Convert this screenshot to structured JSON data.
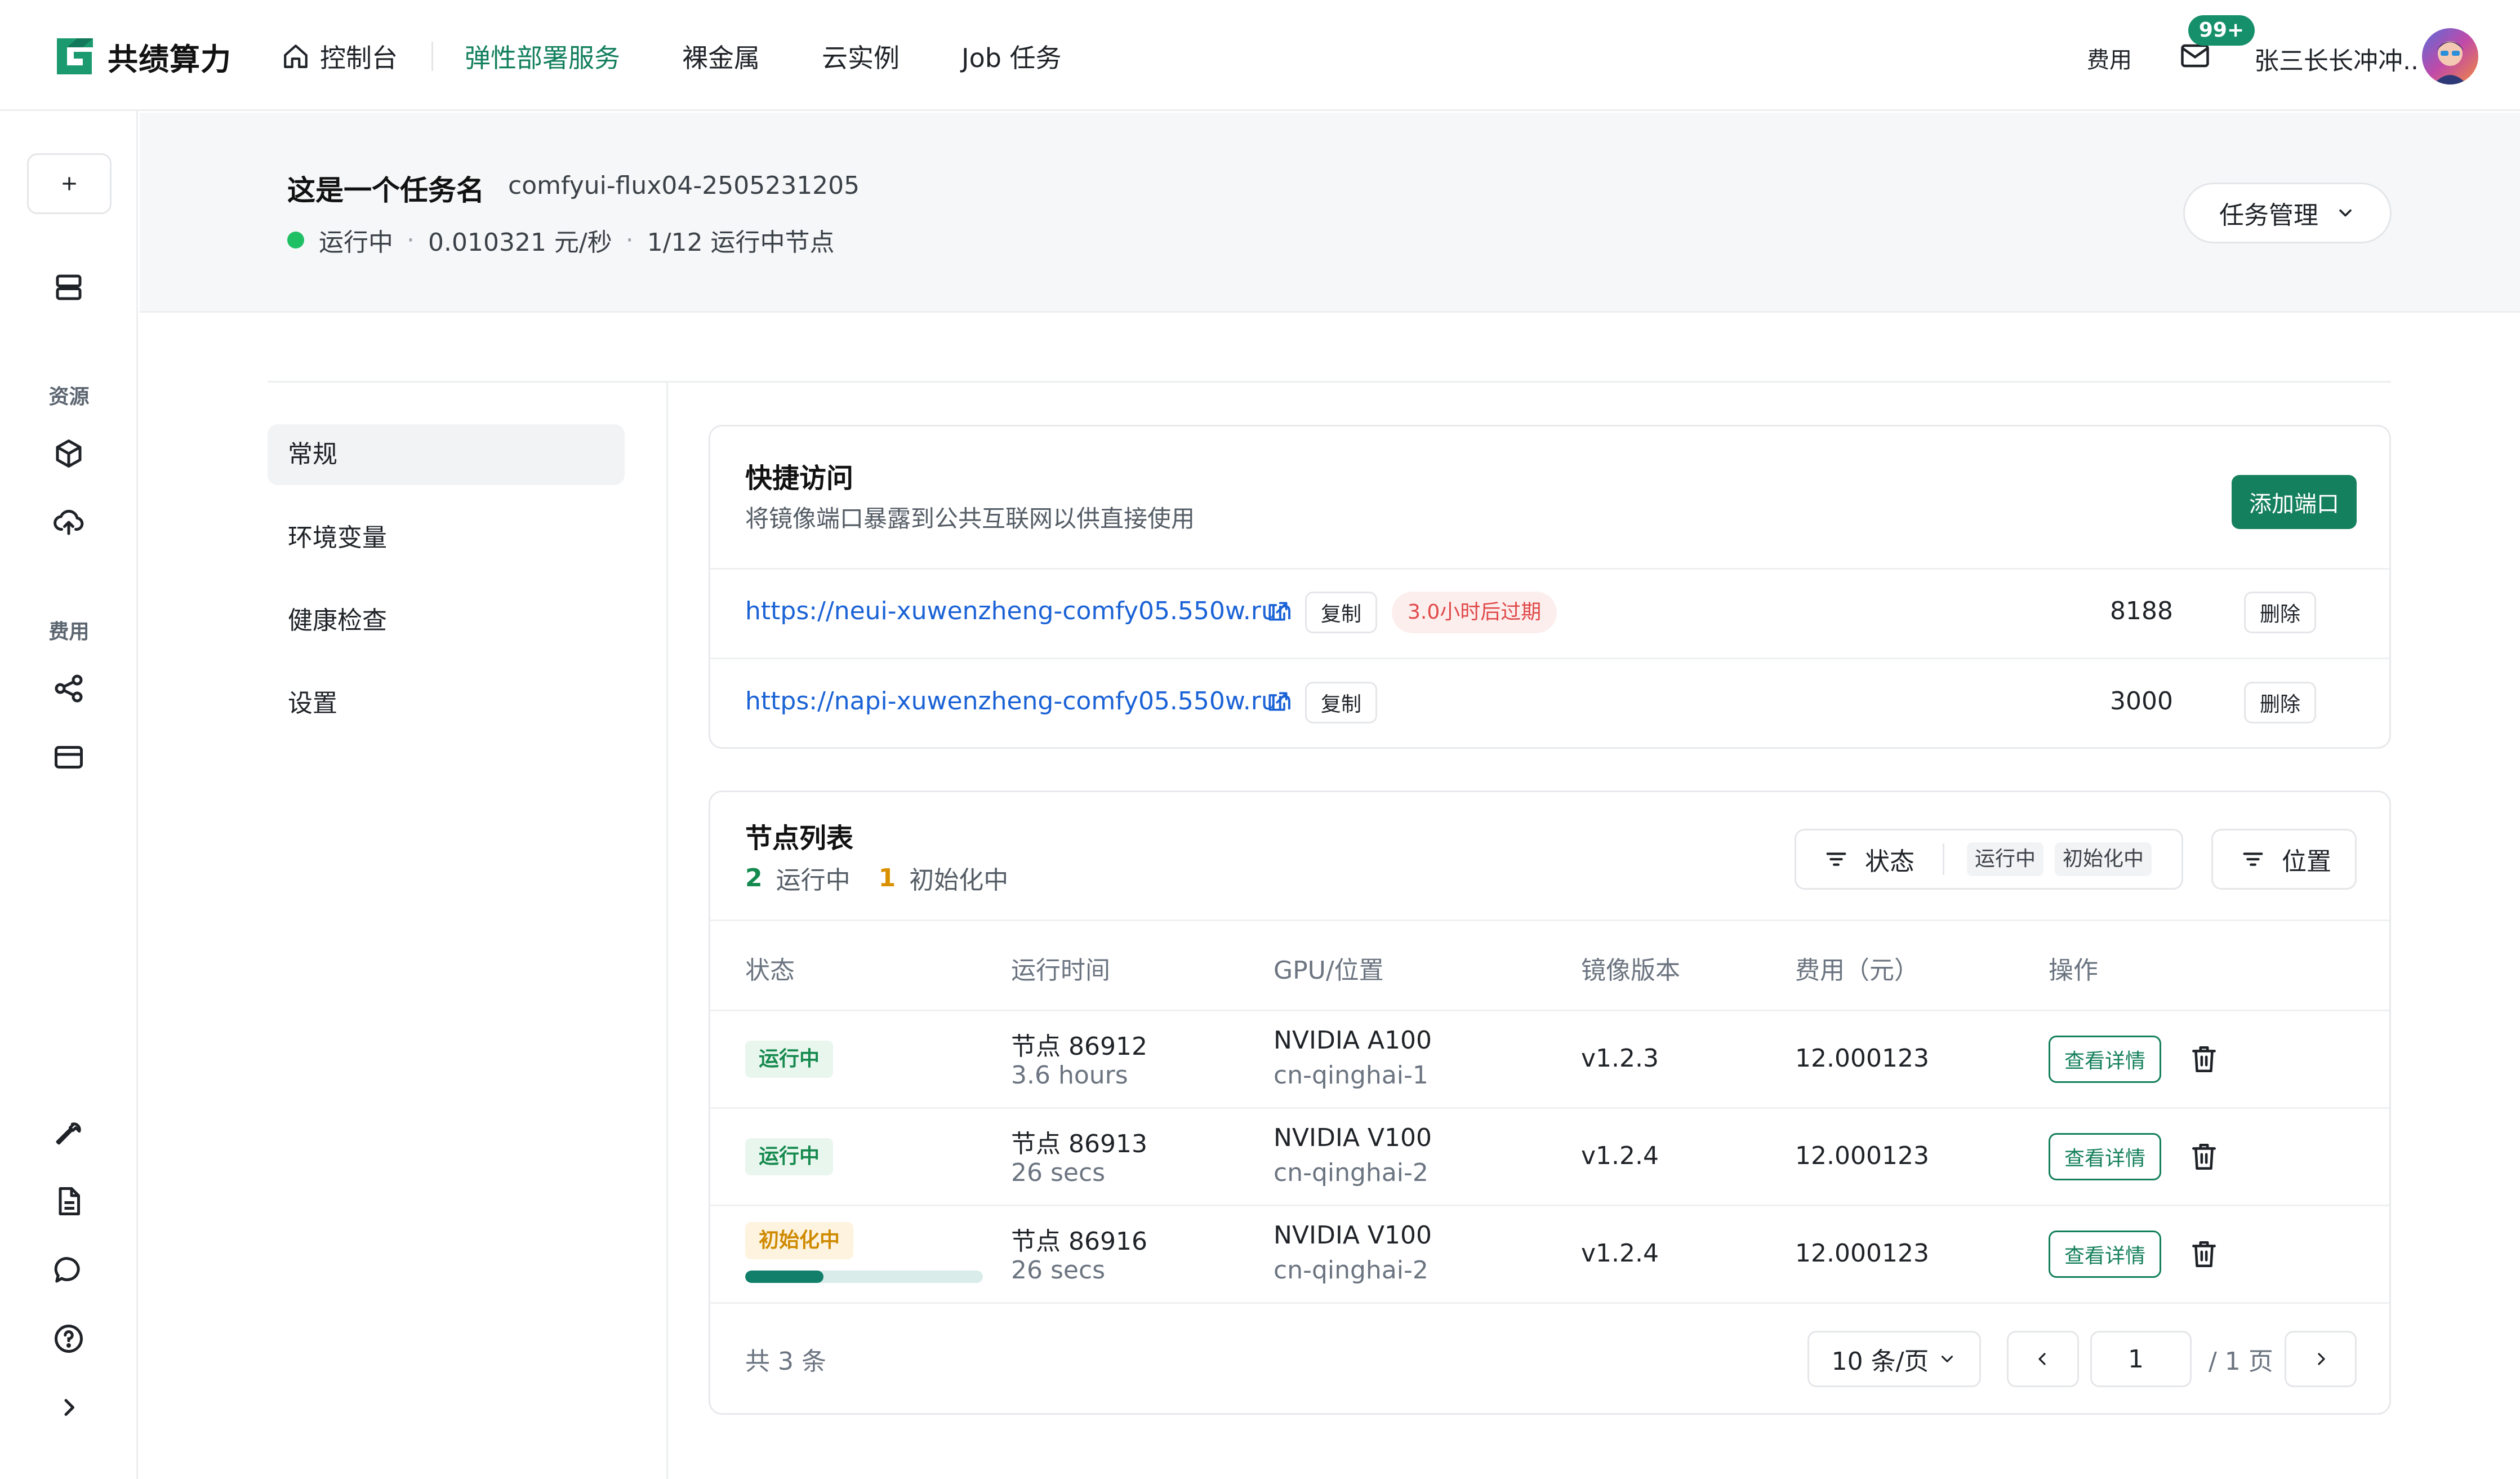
{
  "brand": {
    "name": "共绩算力",
    "accent": "#16906a"
  },
  "nav": {
    "items": [
      {
        "label": "控制台",
        "icon": "home-icon"
      },
      {
        "label": "弹性部署服务",
        "active": true
      },
      {
        "label": "裸金属"
      },
      {
        "label": "云实例"
      },
      {
        "label": "Job 任务"
      }
    ]
  },
  "user": {
    "fee_label": "费用",
    "mail_badge": "99+",
    "name": "张三长长冲冲.."
  },
  "rail": {
    "section_resources": "资源",
    "section_fees": "费用"
  },
  "task": {
    "title": "这是一个任务名",
    "code": "comfyui-flux04-2505231205",
    "status": "运行中",
    "price": "0.010321 元/秒",
    "nodes": "1/12 运行中节点",
    "manage_label": "任务管理"
  },
  "subnav": {
    "items": [
      {
        "label": "常规",
        "active": true
      },
      {
        "label": "环境变量"
      },
      {
        "label": "健康检查"
      },
      {
        "label": "设置"
      }
    ]
  },
  "quick_access": {
    "title": "快捷访问",
    "subtitle": "将镜像端口暴露到公共互联网以供直接使用",
    "add_label": "添加端口",
    "copy_label": "复制",
    "delete_label": "删除",
    "rows": [
      {
        "url": "https://neui-xuwenzheng-comfy05.550w.run",
        "expire": "3.0小时后过期",
        "port": "8188"
      },
      {
        "url": "https://napi-xuwenzheng-comfy05.550w.run",
        "port": "3000"
      }
    ]
  },
  "node_list": {
    "title": "节点列表",
    "running_count": "2",
    "running_label": "运行中",
    "init_count": "1",
    "init_label": "初始化中",
    "filter_status_label": "状态",
    "filter_chips": [
      "运行中",
      "初始化中"
    ],
    "filter_location_label": "位置",
    "columns": [
      "状态",
      "运行时间",
      "GPU/位置",
      "镜像版本",
      "费用（元）",
      "操作"
    ],
    "detail_label": "查看详情",
    "rows": [
      {
        "status": "运行中",
        "node": "节点 86912",
        "time": "3.6 hours",
        "gpu": "NVIDIA A100",
        "location": "cn-qinghai-1",
        "version": "v1.2.3",
        "fee": "12.000123"
      },
      {
        "status": "运行中",
        "node": "节点 86913",
        "time": "26 secs",
        "gpu": "NVIDIA V100",
        "location": "cn-qinghai-2",
        "version": "v1.2.4",
        "fee": "12.000123"
      },
      {
        "status": "初始化中",
        "node": "节点 86916",
        "time": "26 secs",
        "gpu": "NVIDIA V100",
        "location": "cn-qinghai-2",
        "version": "v1.2.4",
        "fee": "12.000123",
        "progress": 0.33
      }
    ],
    "total": "共 3 条",
    "page_size": "10 条/页",
    "page": "1",
    "page_total": "/ 1 页"
  }
}
